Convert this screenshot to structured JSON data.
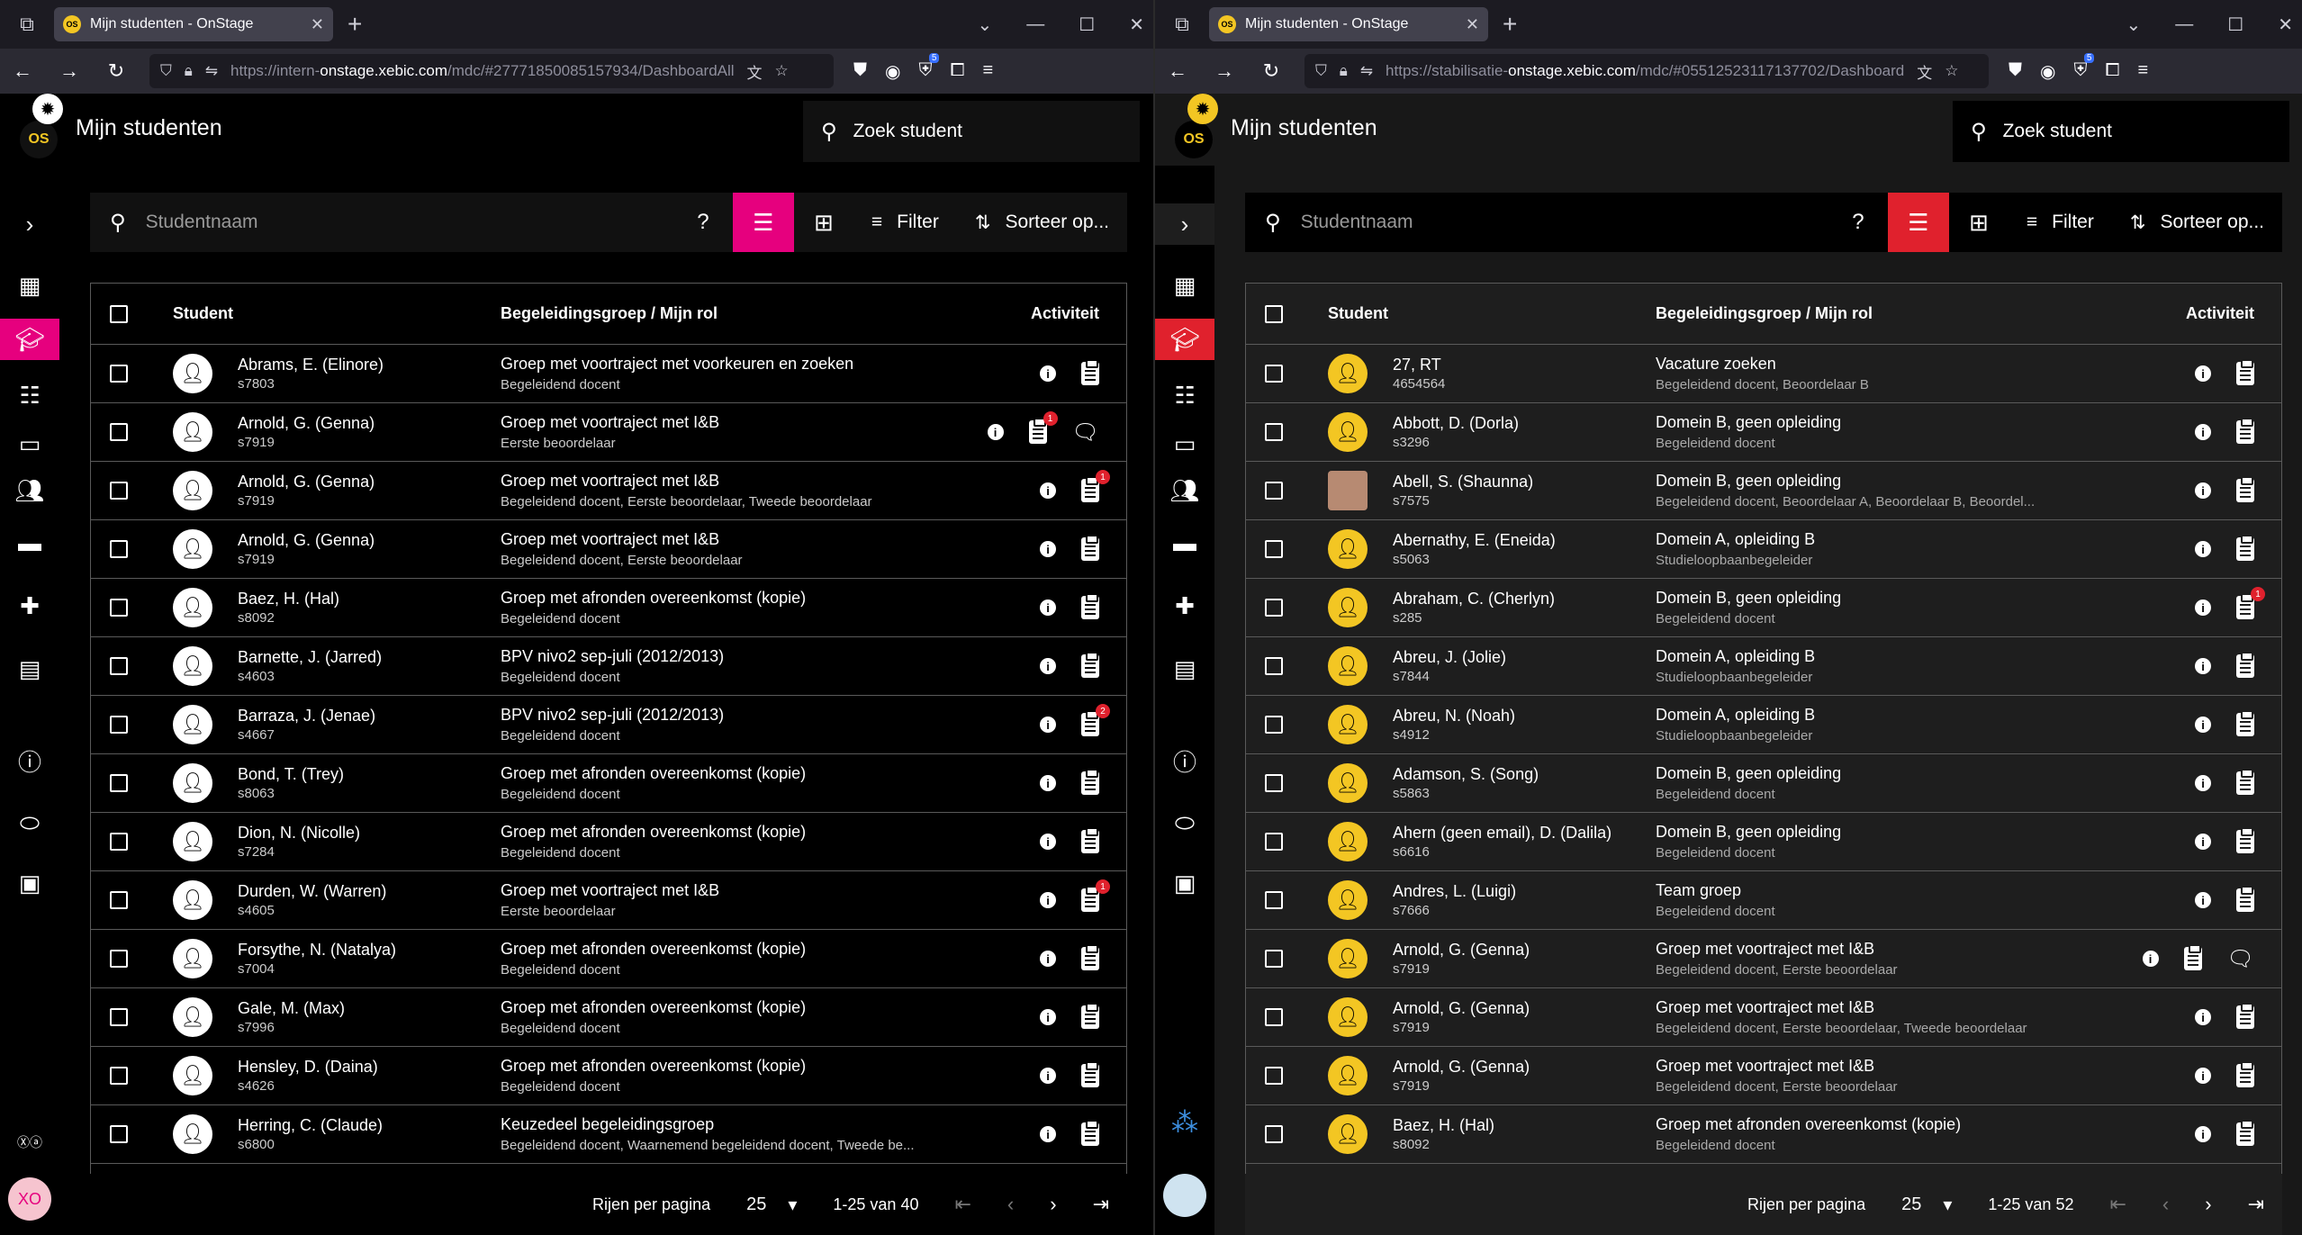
{
  "left": {
    "tab_title": "Mijn studenten - OnStage",
    "url_prefix": "https://intern-",
    "url_domain": "onstage.xebic.com",
    "url_rest": "/mdc/#27771850085157934/DashboardAll",
    "favicon_text": "OS",
    "page_title": "Mijn studenten",
    "search_student": "Zoek student",
    "search_placeholder": "Studentnaam",
    "filter_label": "Filter",
    "sort_label": "Sorteer op...",
    "col_student": "Student",
    "col_group": "Begeleidingsgroep / Mijn rol",
    "col_activity": "Activiteit",
    "rows_per_page_label": "Rijen per pagina",
    "rows_per_page": "25",
    "range": "1-25 van 40",
    "user_initials": "XO",
    "rows": [
      {
        "name": "Abrams, E. (Elinore)",
        "id": "s7803",
        "group": "Groep met voortraject met voorkeuren en zoeken",
        "role": "Begeleidend docent",
        "badge": "",
        "chat": false
      },
      {
        "name": "Arnold, G. (Genna)",
        "id": "s7919",
        "group": "Groep met voortraject met I&B",
        "role": "Eerste beoordelaar",
        "badge": "1",
        "chat": true
      },
      {
        "name": "Arnold, G. (Genna)",
        "id": "s7919",
        "group": "Groep met voortraject met I&B",
        "role": "Begeleidend docent, Eerste beoordelaar, Tweede beoordelaar",
        "badge": "1",
        "chat": false
      },
      {
        "name": "Arnold, G. (Genna)",
        "id": "s7919",
        "group": "Groep met voortraject met I&B",
        "role": "Begeleidend docent, Eerste beoordelaar",
        "badge": "",
        "chat": false
      },
      {
        "name": "Baez, H. (Hal)",
        "id": "s8092",
        "group": "Groep met afronden overeenkomst (kopie)",
        "role": "Begeleidend docent",
        "badge": "",
        "chat": false
      },
      {
        "name": "Barnette, J. (Jarred)",
        "id": "s4603",
        "group": "BPV nivo2 sep-juli (2012/2013)",
        "role": "Begeleidend docent",
        "badge": "",
        "chat": false
      },
      {
        "name": "Barraza, J. (Jenae)",
        "id": "s4667",
        "group": "BPV nivo2 sep-juli (2012/2013)",
        "role": "Begeleidend docent",
        "badge": "2",
        "chat": false
      },
      {
        "name": "Bond, T. (Trey)",
        "id": "s8063",
        "group": "Groep met afronden overeenkomst (kopie)",
        "role": "Begeleidend docent",
        "badge": "",
        "chat": false
      },
      {
        "name": "Dion, N. (Nicolle)",
        "id": "s7284",
        "group": "Groep met afronden overeenkomst (kopie)",
        "role": "Begeleidend docent",
        "badge": "",
        "chat": false
      },
      {
        "name": "Durden, W. (Warren)",
        "id": "s4605",
        "group": "Groep met voortraject met I&B",
        "role": "Eerste beoordelaar",
        "badge": "1",
        "chat": false
      },
      {
        "name": "Forsythe, N. (Natalya)",
        "id": "s7004",
        "group": "Groep met afronden overeenkomst (kopie)",
        "role": "Begeleidend docent",
        "badge": "",
        "chat": false
      },
      {
        "name": "Gale, M. (Max)",
        "id": "s7996",
        "group": "Groep met afronden overeenkomst (kopie)",
        "role": "Begeleidend docent",
        "badge": "",
        "chat": false
      },
      {
        "name": "Hensley, D. (Daina)",
        "id": "s4626",
        "group": "Groep met afronden overeenkomst (kopie)",
        "role": "Begeleidend docent",
        "badge": "",
        "chat": false
      },
      {
        "name": "Herring, C. (Claude)",
        "id": "s6800",
        "group": "Keuzedeel begeleidingsgroep",
        "role": "Begeleidend docent, Waarnemend begeleidend docent, Tweede be...",
        "badge": "",
        "chat": false
      }
    ]
  },
  "right": {
    "tab_title": "Mijn studenten - OnStage",
    "url_prefix": "https://stabilisatie-",
    "url_domain": "onstage.xebic.com",
    "url_rest": "/mdc/#05512523117137702/Dashboard",
    "favicon_text": "OS",
    "page_title": "Mijn studenten",
    "search_student": "Zoek student",
    "search_placeholder": "Studentnaam",
    "filter_label": "Filter",
    "sort_label": "Sorteer op...",
    "col_student": "Student",
    "col_group": "Begeleidingsgroep / Mijn rol",
    "col_activity": "Activiteit",
    "rows_per_page_label": "Rijen per pagina",
    "rows_per_page": "25",
    "range": "1-25 van 52",
    "rows": [
      {
        "name": "27, RT",
        "id": "4654564",
        "group": "Vacature zoeken",
        "role": "Begeleidend docent, Beoordelaar B",
        "badge": "",
        "chat": false
      },
      {
        "name": "Abbott, D. (Dorla)",
        "id": "s3296",
        "group": "Domein B, geen opleiding",
        "role": "Begeleidend docent",
        "badge": "",
        "chat": false
      },
      {
        "name": "Abell, S. (Shaunna)",
        "id": "s7575",
        "group": "Domein B, geen opleiding",
        "role": "Begeleidend docent, Beoordelaar A, Beoordelaar B, Beoordel...",
        "badge": "",
        "chat": false,
        "photo": true
      },
      {
        "name": "Abernathy, E. (Eneida)",
        "id": "s5063",
        "group": "Domein A, opleiding B",
        "role": "Studieloopbaanbegeleider",
        "badge": "",
        "chat": false
      },
      {
        "name": "Abraham, C. (Cherlyn)",
        "id": "s285",
        "group": "Domein B, geen opleiding",
        "role": "Begeleidend docent",
        "badge": "1",
        "chat": false
      },
      {
        "name": "Abreu, J. (Jolie)",
        "id": "s7844",
        "group": "Domein A, opleiding B",
        "role": "Studieloopbaanbegeleider",
        "badge": "",
        "chat": false
      },
      {
        "name": "Abreu, N. (Noah)",
        "id": "s4912",
        "group": "Domein A, opleiding B",
        "role": "Studieloopbaanbegeleider",
        "badge": "",
        "chat": false
      },
      {
        "name": "Adamson, S. (Song)",
        "id": "s5863",
        "group": "Domein B, geen opleiding",
        "role": "Begeleidend docent",
        "badge": "",
        "chat": false
      },
      {
        "name": "Ahern (geen email), D. (Dalila)",
        "id": "s6616",
        "group": "Domein B, geen opleiding",
        "role": "Begeleidend docent",
        "badge": "",
        "chat": false
      },
      {
        "name": "Andres, L. (Luigi)",
        "id": "s7666",
        "group": "Team groep",
        "role": "Begeleidend docent",
        "badge": "",
        "chat": false
      },
      {
        "name": "Arnold, G. (Genna)",
        "id": "s7919",
        "group": "Groep met voortraject met I&B",
        "role": "Begeleidend docent, Eerste beoordelaar",
        "badge": "",
        "chat": true
      },
      {
        "name": "Arnold, G. (Genna)",
        "id": "s7919",
        "group": "Groep met voortraject met I&B",
        "role": "Begeleidend docent, Eerste beoordelaar, Tweede beoordelaar",
        "badge": "",
        "chat": false
      },
      {
        "name": "Arnold, G. (Genna)",
        "id": "s7919",
        "group": "Groep met voortraject met I&B",
        "role": "Begeleidend docent, Eerste beoordelaar",
        "badge": "",
        "chat": false
      },
      {
        "name": "Baez, H. (Hal)",
        "id": "s8092",
        "group": "Groep met afronden overeenkomst (kopie)",
        "role": "Begeleidend docent",
        "badge": "",
        "chat": false
      }
    ]
  },
  "colors": {
    "pink_accent": "#e6007e",
    "red_accent": "#e0212d",
    "yellow_avatar": "#f3c623"
  }
}
